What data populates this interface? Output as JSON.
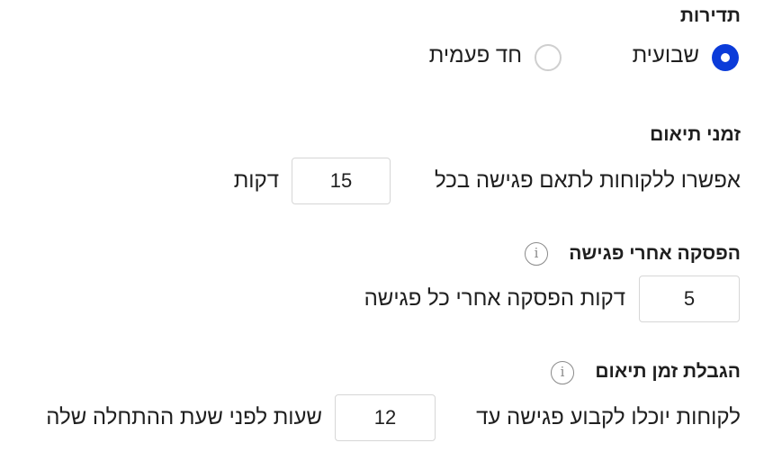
{
  "frequency": {
    "heading": "תדירות",
    "options": [
      {
        "label": "שבועית",
        "selected": true
      },
      {
        "label": "חד פעמית",
        "selected": false
      }
    ]
  },
  "scheduling_times": {
    "heading": "זמני תיאום",
    "sentence_before": "אפשרו ללקוחות לתאם פגישה בכל",
    "value": "15",
    "sentence_after": "דקות"
  },
  "break_after": {
    "heading": "הפסקה אחרי פגישה",
    "info_icon": "info-icon",
    "value": "5",
    "sentence_after": "דקות הפסקה אחרי כל פגישה"
  },
  "scheduling_limit": {
    "heading": "הגבלת זמן תיאום",
    "info_icon": "info-icon",
    "sentence_before": "לקוחות יוכלו לקבוע פגישה עד",
    "value": "12",
    "sentence_after": "שעות לפני שעת ההתחלה שלה"
  },
  "colors": {
    "accent": "#0b3bd9",
    "text": "#1f1f1f",
    "border": "#d6d6d6"
  }
}
